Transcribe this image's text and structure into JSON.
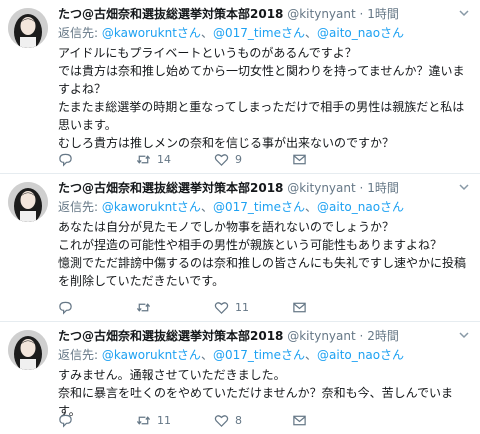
{
  "author": {
    "name": "たつ@古畑奈和選抜総選挙対策本部2018",
    "handle": "@kitynyant"
  },
  "reply_prefix": "返信先:",
  "mentions": [
    "@kaworukntさん",
    "@017_timeさん",
    "@aito_naoさん"
  ],
  "mention_sep": "、",
  "tweets": [
    {
      "time": "1時間",
      "body": [
        "アイドルにもプライベートというものがあるんですよ？",
        "では貴方は奈和推し始めてから一切女性と関わりを持ってませんか？違いますよね？",
        "たまたま総選挙の時期と重なってしまっただけで相手の男性は親族だと私は思います。",
        "むしろ貴方は推しメンの奈和を信じる事が出来ないのですか？"
      ],
      "reply_count": "",
      "retweet_count": "14",
      "like_count": "9"
    },
    {
      "time": "1時間",
      "body": [
        "あなたは自分が見たモノでしか物事を語れないのでしょうか？",
        "これが捏造の可能性や相手の男性が親族という可能性もありますよね？",
        "憶測でただ誹謗中傷するのは奈和推しの皆さんにも失礼ですし速やかに投稿を削除していただきたいです。"
      ],
      "reply_count": "",
      "retweet_count": "",
      "like_count": "11"
    },
    {
      "time": "2時間",
      "body": [
        "すみません。通報させていただきました。",
        "奈和に暴言を吐くのをやめていただけませんか？奈和も今、苦しんでいます。"
      ],
      "reply_count": "",
      "retweet_count": "11",
      "like_count": "8"
    }
  ],
  "icons": {
    "reply": "reply-icon",
    "retweet": "retweet-icon",
    "like": "heart-icon",
    "caret": "chevron-down-icon"
  },
  "colors": {
    "link": "#1da1f2",
    "muted": "#657786",
    "text": "#14171a"
  }
}
